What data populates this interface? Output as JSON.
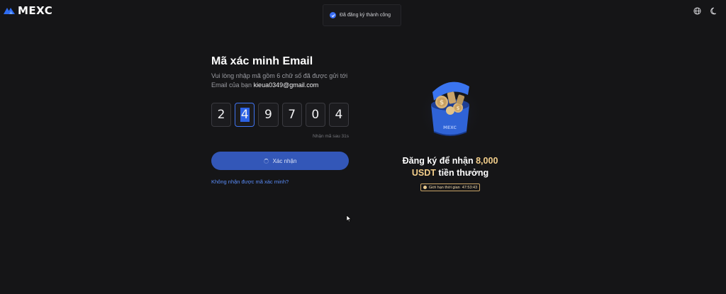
{
  "header": {
    "logo_text": "MEXC",
    "globe_icon": "globe-icon",
    "theme_icon": "moon-icon"
  },
  "toast": {
    "text": "Đã đăng ký thành công",
    "icon": "check-circle-icon"
  },
  "form": {
    "title": "Mã xác minh Email",
    "description": "Vui lòng nhập mã gồm 6 chữ số đã được gửi tới Email của bạn",
    "email": "kieua0349@gmail.com",
    "code_digits": [
      "2",
      "4",
      "9",
      "7",
      "0",
      "4"
    ],
    "resend_text": "Nhận mã sau 31s",
    "submit_label": "Xác nhận",
    "no_code_link": "Không nhận được mã xác minh?"
  },
  "promo": {
    "title_prefix": "Đăng ký để nhận",
    "amount": "8,000",
    "currency": "USDT",
    "title_suffix": "tiền thưởng",
    "timer_label": "Giới hạn thời gian",
    "timer_value": "47:53:43",
    "graphic_label": "MEXC"
  },
  "colors": {
    "background": "#151517",
    "accent": "#3357b8",
    "gold": "#f4cf8b",
    "link": "#5a8cf8"
  }
}
